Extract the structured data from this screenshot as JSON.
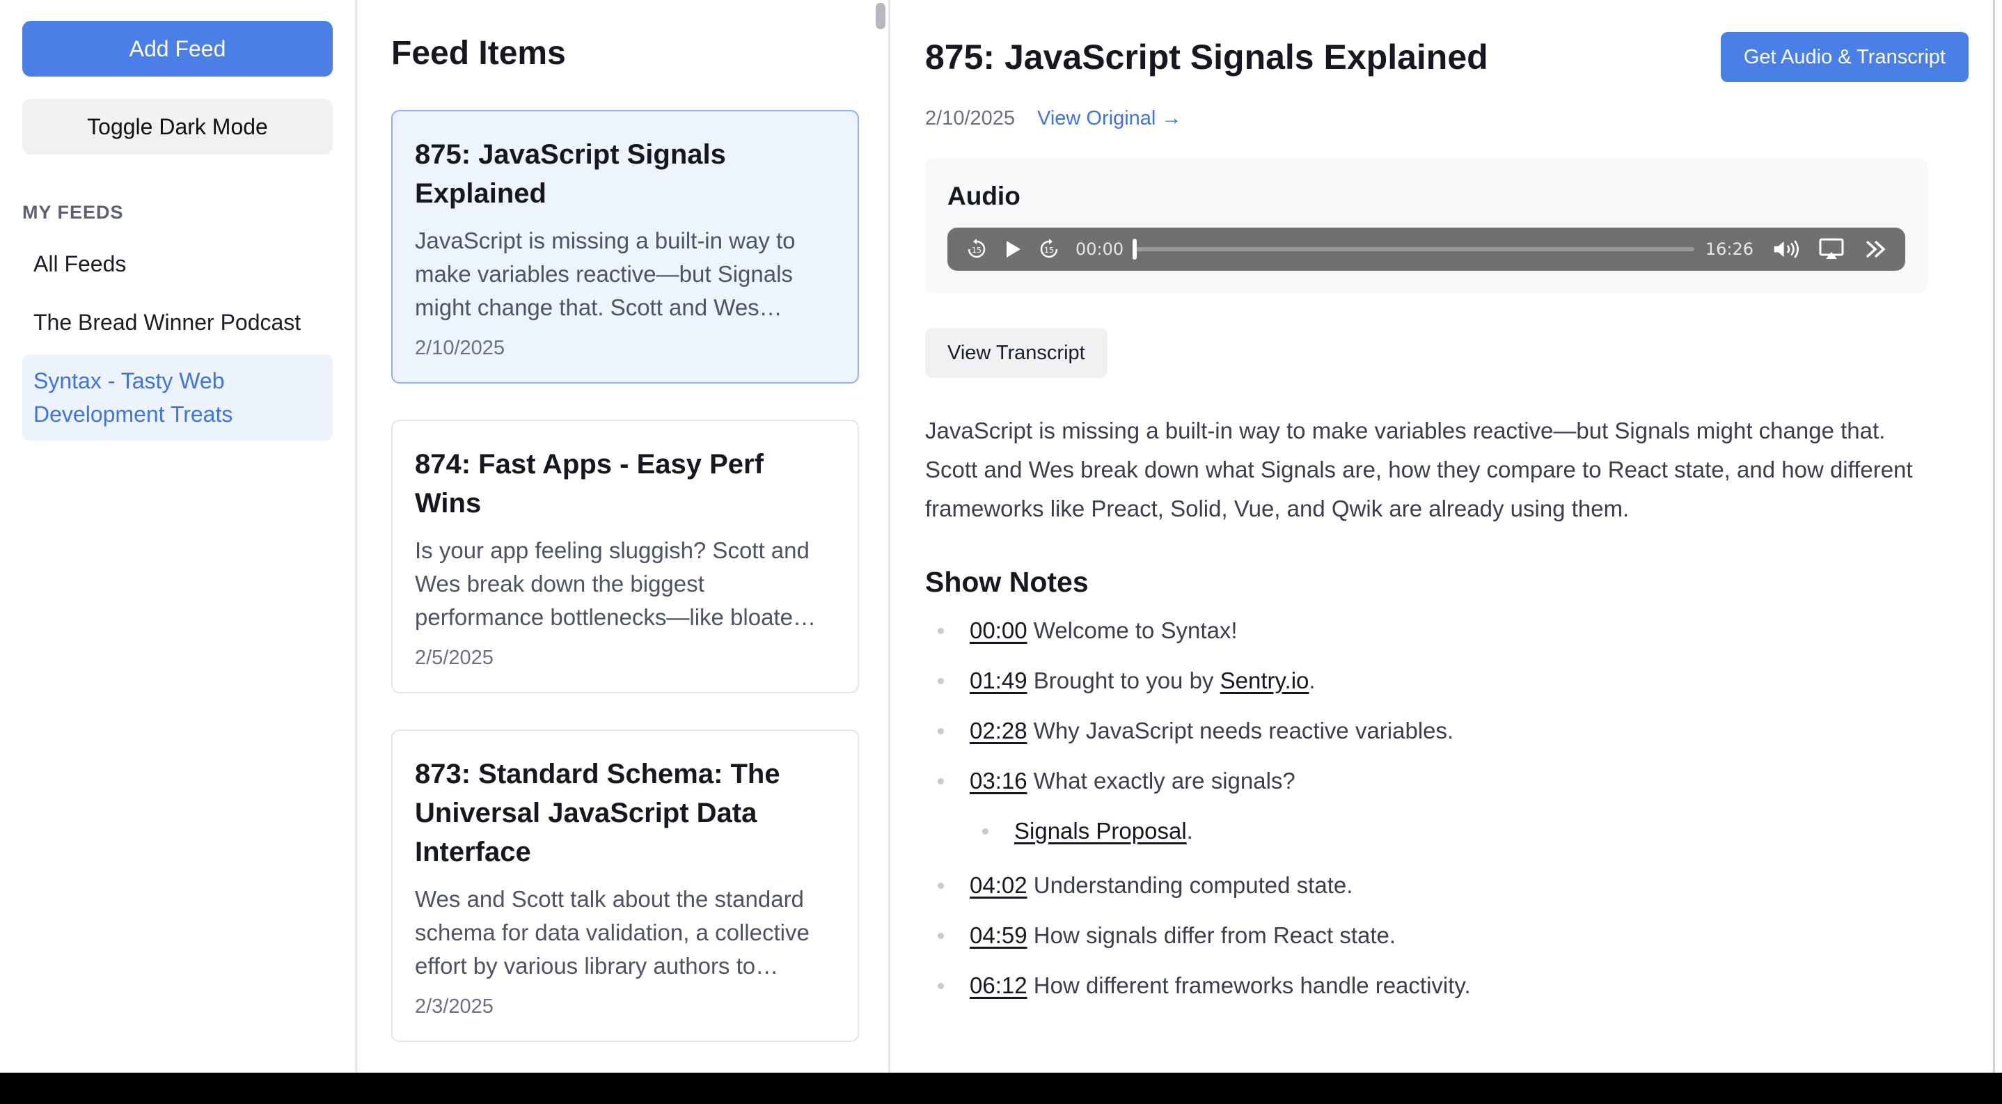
{
  "sidebar": {
    "add_feed": "Add Feed",
    "toggle_dark": "Toggle Dark Mode",
    "section_label": "MY FEEDS",
    "feeds": [
      {
        "label": "All Feeds",
        "active": false
      },
      {
        "label": "The Bread Winner Podcast",
        "active": false
      },
      {
        "label": "Syntax - Tasty Web Development Treats",
        "active": true
      }
    ]
  },
  "middle": {
    "heading": "Feed Items",
    "items": [
      {
        "title": "875: JavaScript Signals Explained",
        "desc": "JavaScript is missing a built-in way to make variables reactive—but Signals might change that. Scott and Wes…",
        "date": "2/10/2025",
        "selected": true
      },
      {
        "title": "874: Fast Apps - Easy Perf Wins",
        "desc": "Is your app feeling sluggish? Scott and Wes break down the biggest performance bottlenecks—like bloate…",
        "date": "2/5/2025",
        "selected": false
      },
      {
        "title": "873: Standard Schema: The Universal JavaScript Data Interface",
        "desc": "Wes and Scott talk about the standard schema for data validation, a collective effort by various library authors to…",
        "date": "2/3/2025",
        "selected": false
      }
    ]
  },
  "detail": {
    "title": "875: JavaScript Signals Explained",
    "get_button": "Get Audio & Transcript",
    "date": "2/10/2025",
    "view_original": "View Original →",
    "audio_label": "Audio",
    "player": {
      "current": "00:00",
      "duration": "16:26",
      "progress": 0
    },
    "view_transcript": "View Transcript",
    "description": "JavaScript is missing a built-in way to make variables reactive—but Signals might change that. Scott and Wes break down what Signals are, how they compare to React state, and how different frameworks like Preact, Solid, Vue, and Qwik are already using them.",
    "show_notes_title": "Show Notes",
    "notes": [
      {
        "ts": "00:00",
        "text": " Welcome to Syntax!"
      },
      {
        "ts": "01:49",
        "text": " Brought to you by ",
        "link": "Sentry.io",
        "after": "."
      },
      {
        "ts": "02:28",
        "text": " Why JavaScript needs reactive variables."
      },
      {
        "ts": "03:16",
        "text": " What exactly are signals?"
      },
      {
        "sub": true,
        "link": "Signals Proposal",
        "after": "."
      },
      {
        "ts": "04:02",
        "text": " Understanding computed state."
      },
      {
        "ts": "04:59",
        "text": " How signals differ from React state."
      },
      {
        "ts": "06:12",
        "text": " How different frameworks handle reactivity."
      }
    ]
  },
  "colors": {
    "accent": "#4a7fe8",
    "accent_text": "#3d74e0",
    "selected_bg": "#eef4fd",
    "player_bg": "#707070"
  }
}
